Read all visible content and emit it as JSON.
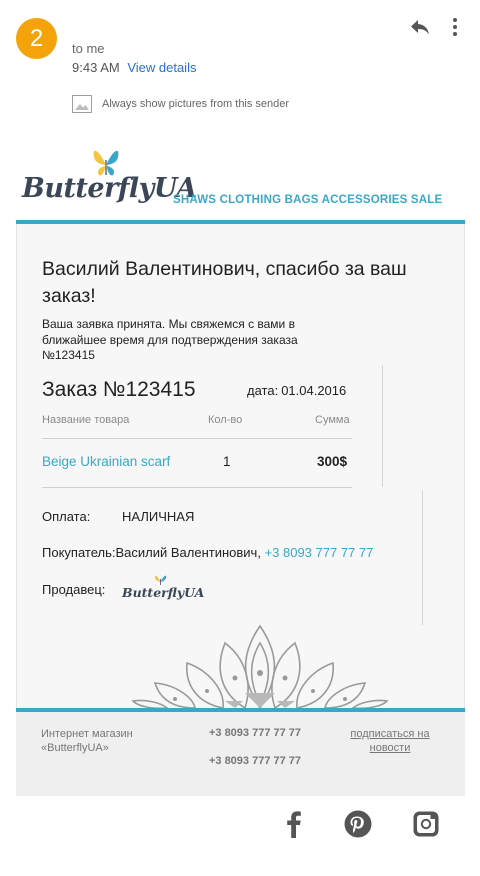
{
  "email_header": {
    "avatar_text": "2",
    "recipient": "to me",
    "time": "9:43 AM",
    "view_details": "View details",
    "show_pictures": "Always show pictures from this sender"
  },
  "brand": {
    "logo_text": "ButterflyUA",
    "categories": "SHAWS CLOTHING BAGS ACCESSORIES SALE",
    "accent_color": "#3aa7c9"
  },
  "confirmation": {
    "title": "Василий Валентинович, спасибо за ваш заказ!",
    "subtitle": "Ваша заявка принята. Мы свяжемся с вами в ближайшее время для подтверждения заказа №123415"
  },
  "order": {
    "number_label": "Заказ №123415",
    "date_label": "дата:",
    "date": "01.04.2016",
    "columns": {
      "product": "Название товара",
      "qty": "Кол-во",
      "sum": "Сумма"
    },
    "items": [
      {
        "product": "Beige Ukrainian scarf",
        "qty": "1",
        "sum": "300$"
      }
    ]
  },
  "details": {
    "payment_label": "Оплата:",
    "payment_value": "НАЛИЧНАЯ",
    "buyer_label": "Покупатель:",
    "buyer_name": "Василий Валентинович,",
    "buyer_phone": "+3 8093 777 77 77",
    "seller_label": "Продавец:"
  },
  "footer": {
    "shop": "Интернет магазин «ButterflyUA»",
    "phone_1": "+3 8093 777 77 77",
    "phone_2": "+3 8093 777 77 77",
    "subscribe": "подписаться на новости"
  },
  "icons": [
    "reply-icon",
    "more-vert-icon",
    "image-icon",
    "facebook-icon",
    "pinterest-icon",
    "instagram-icon"
  ]
}
